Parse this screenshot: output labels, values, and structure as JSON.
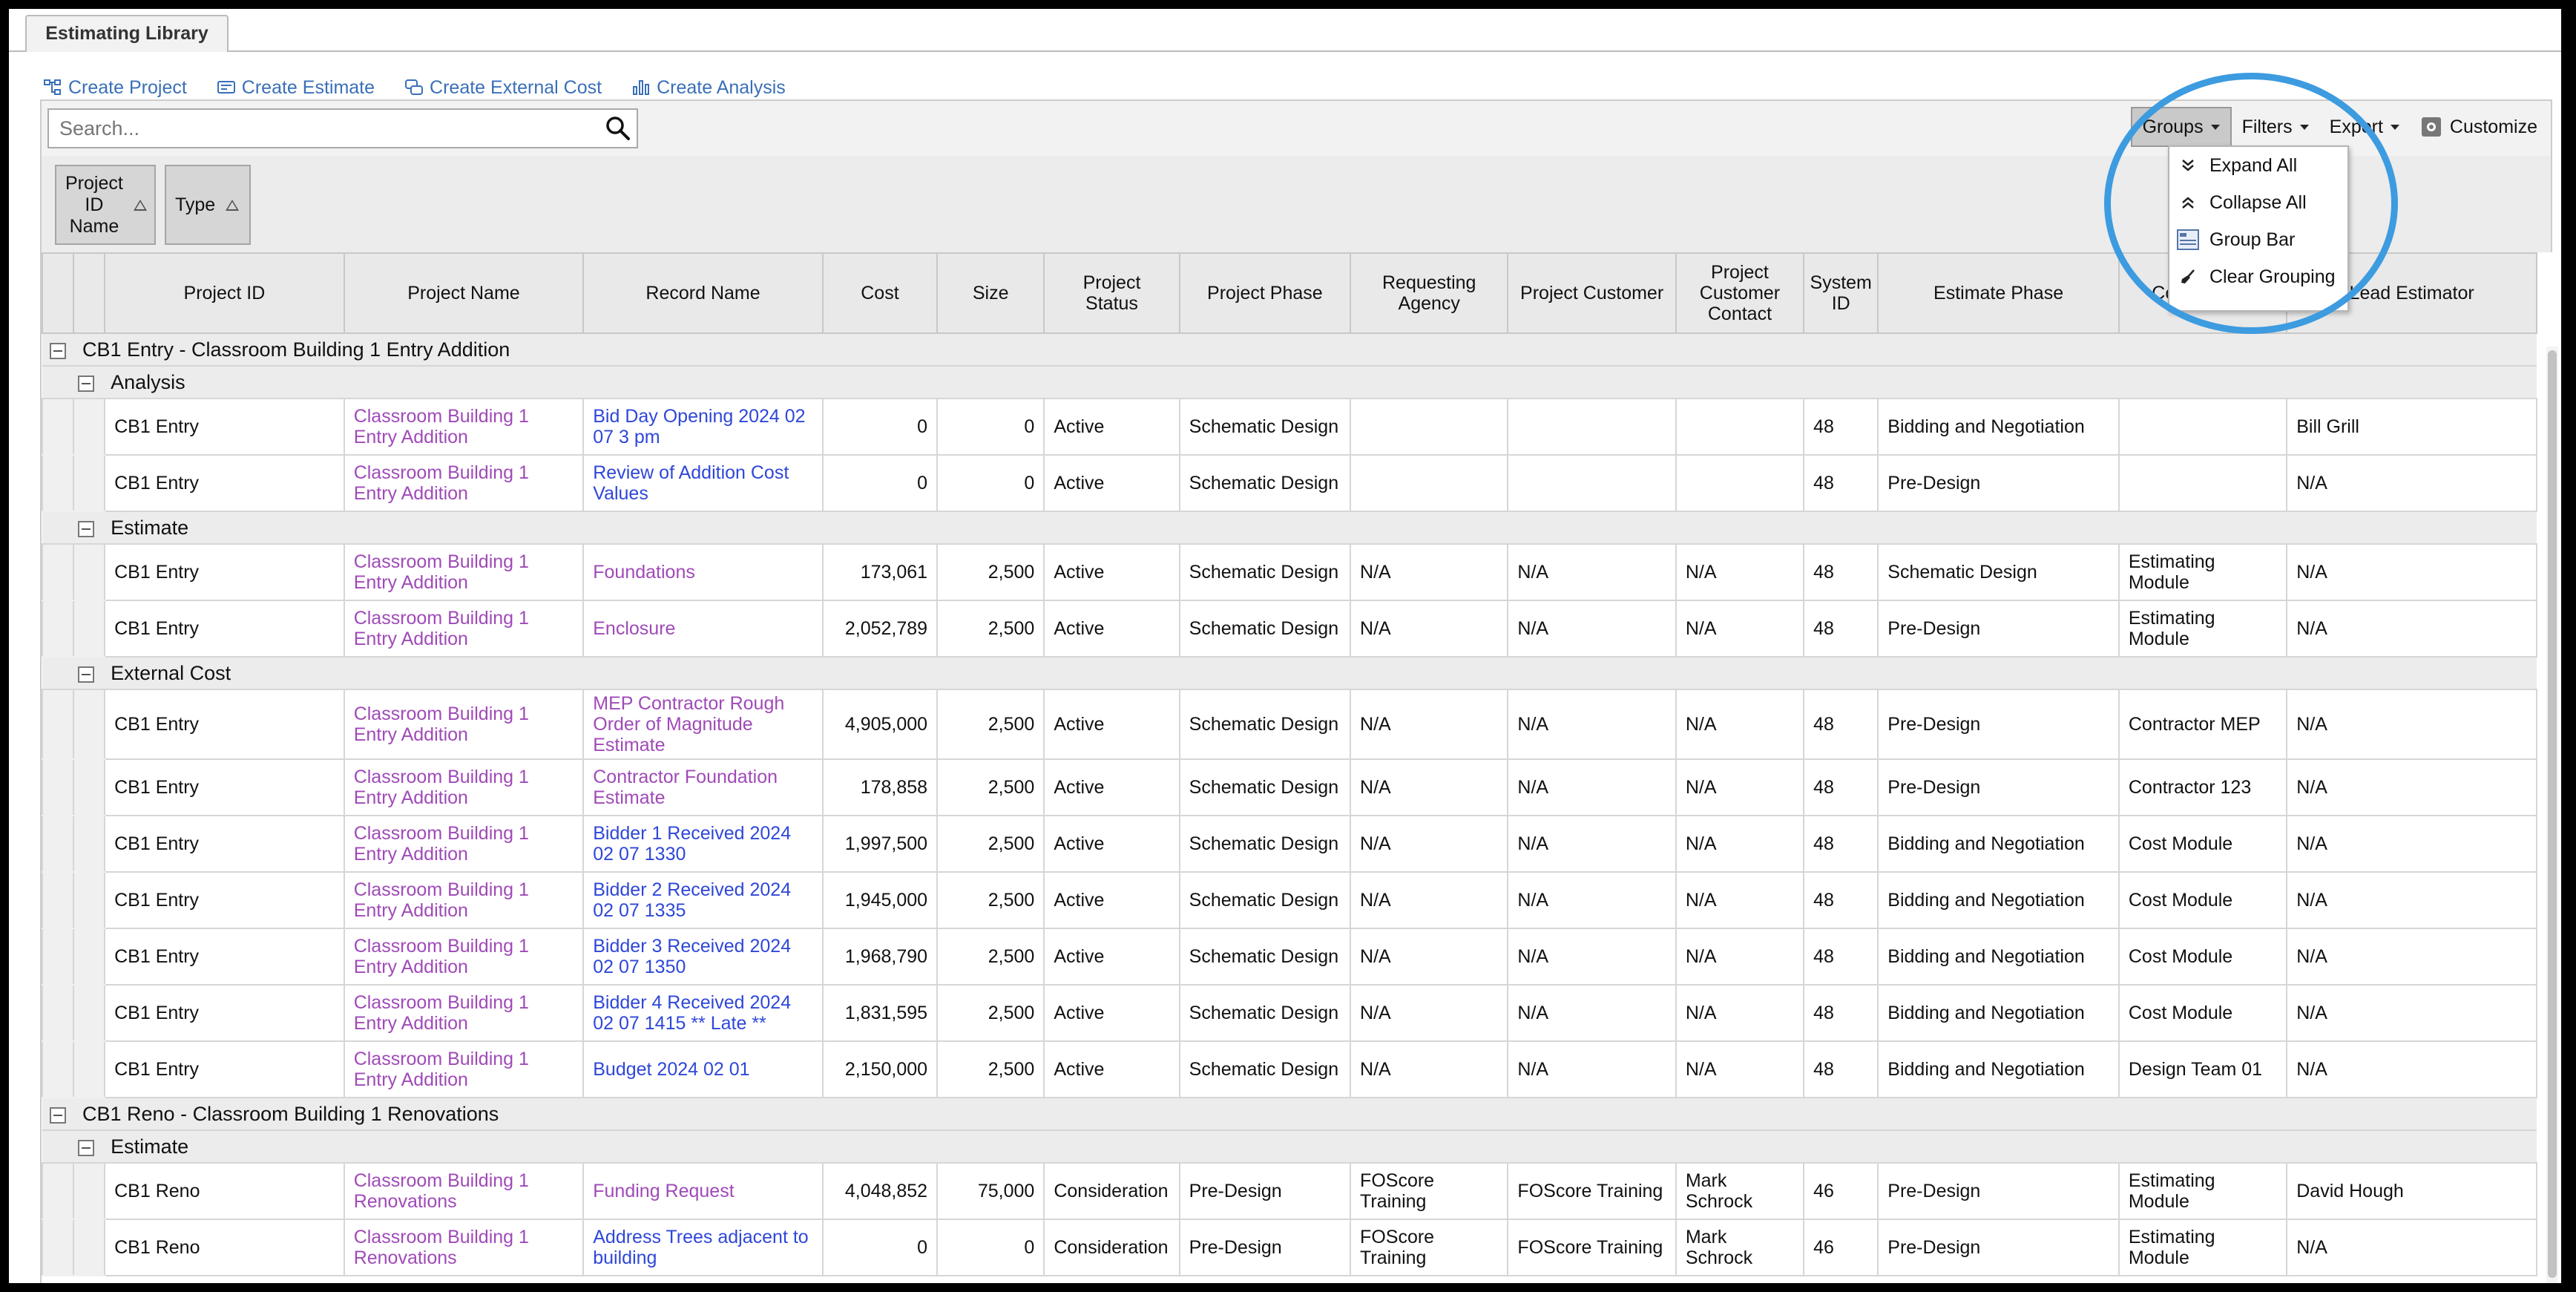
{
  "tab": "Estimating Library",
  "actions": [
    "Create Project",
    "Create Estimate",
    "Create External Cost",
    "Create Analysis"
  ],
  "search": {
    "placeholder": "Search..."
  },
  "toolbar": {
    "groups": "Groups",
    "filters": "Filters",
    "export": "Export",
    "customize": "Customize"
  },
  "group_chips": [
    {
      "lines": [
        "Project",
        "ID",
        "Name"
      ]
    },
    {
      "lines": [
        "Type"
      ]
    }
  ],
  "group_menu": [
    "Expand All",
    "Collapse All",
    "Group Bar",
    "Clear Grouping"
  ],
  "columns": [
    [
      "Project ID"
    ],
    [
      "Project Name"
    ],
    [
      "Record Name"
    ],
    [
      "Cost"
    ],
    [
      "Size"
    ],
    [
      "Project",
      "Status"
    ],
    [
      "Project Phase"
    ],
    [
      "Requesting",
      "Agency"
    ],
    [
      "Project Customer"
    ],
    [
      "Project",
      "Customer",
      "Contact"
    ],
    [
      "System",
      "ID"
    ],
    [
      "Estimate Phase"
    ],
    [
      "Cost Source"
    ],
    [
      "Lead Estimator"
    ]
  ],
  "groups": [
    {
      "label": "CB1 Entry - Classroom Building 1 Entry Addition",
      "subgroups": [
        {
          "label": "Analysis",
          "rows": [
            {
              "cells": [
                "CB1 Entry",
                "Classroom Building 1 Entry Addition",
                "Bid Day Opening 2024 02 07 3 pm",
                "0",
                "0",
                "Active",
                "Schematic Design",
                "",
                "",
                "",
                "48",
                "Bidding and Negotiation",
                "",
                "Bill Grill"
              ],
              "record_color": "blue"
            },
            {
              "cells": [
                "CB1 Entry",
                "Classroom Building 1 Entry Addition",
                "Review of Addition Cost Values",
                "0",
                "0",
                "Active",
                "Schematic Design",
                "",
                "",
                "",
                "48",
                "Pre-Design",
                "",
                "N/A"
              ],
              "record_color": "blue"
            }
          ]
        },
        {
          "label": "Estimate",
          "rows": [
            {
              "cells": [
                "CB1 Entry",
                "Classroom Building 1 Entry Addition",
                "Foundations",
                "173,061",
                "2,500",
                "Active",
                "Schematic Design",
                "N/A",
                "N/A",
                "N/A",
                "48",
                "Schematic Design",
                "Estimating Module",
                "N/A"
              ],
              "record_color": "purple"
            },
            {
              "cells": [
                "CB1 Entry",
                "Classroom Building 1 Entry Addition",
                "Enclosure",
                "2,052,789",
                "2,500",
                "Active",
                "Schematic Design",
                "N/A",
                "N/A",
                "N/A",
                "48",
                "Pre-Design",
                "Estimating Module",
                "N/A"
              ],
              "record_color": "purple"
            }
          ]
        },
        {
          "label": "External Cost",
          "rows": [
            {
              "cells": [
                "CB1 Entry",
                "Classroom Building 1 Entry Addition",
                "MEP Contractor Rough Order of Magnitude Estimate",
                "4,905,000",
                "2,500",
                "Active",
                "Schematic Design",
                "N/A",
                "N/A",
                "N/A",
                "48",
                "Pre-Design",
                "Contractor MEP",
                "N/A"
              ],
              "record_color": "purple"
            },
            {
              "cells": [
                "CB1 Entry",
                "Classroom Building 1 Entry Addition",
                "Contractor Foundation Estimate",
                "178,858",
                "2,500",
                "Active",
                "Schematic Design",
                "N/A",
                "N/A",
                "N/A",
                "48",
                "Pre-Design",
                "Contractor 123",
                "N/A"
              ],
              "record_color": "purple"
            },
            {
              "cells": [
                "CB1 Entry",
                "Classroom Building 1 Entry Addition",
                "Bidder 1 Received 2024 02 07 1330",
                "1,997,500",
                "2,500",
                "Active",
                "Schematic Design",
                "N/A",
                "N/A",
                "N/A",
                "48",
                "Bidding and Negotiation",
                "Cost Module",
                "N/A"
              ],
              "record_color": "blue"
            },
            {
              "cells": [
                "CB1 Entry",
                "Classroom Building 1 Entry Addition",
                "Bidder 2 Received 2024 02 07 1335",
                "1,945,000",
                "2,500",
                "Active",
                "Schematic Design",
                "N/A",
                "N/A",
                "N/A",
                "48",
                "Bidding and Negotiation",
                "Cost Module",
                "N/A"
              ],
              "record_color": "blue"
            },
            {
              "cells": [
                "CB1 Entry",
                "Classroom Building 1 Entry Addition",
                "Bidder 3 Received 2024 02 07 1350",
                "1,968,790",
                "2,500",
                "Active",
                "Schematic Design",
                "N/A",
                "N/A",
                "N/A",
                "48",
                "Bidding and Negotiation",
                "Cost Module",
                "N/A"
              ],
              "record_color": "blue"
            },
            {
              "cells": [
                "CB1 Entry",
                "Classroom Building 1 Entry Addition",
                "Bidder 4 Received 2024 02 07 1415 ** Late **",
                "1,831,595",
                "2,500",
                "Active",
                "Schematic Design",
                "N/A",
                "N/A",
                "N/A",
                "48",
                "Bidding and Negotiation",
                "Cost Module",
                "N/A"
              ],
              "record_color": "blue"
            },
            {
              "cells": [
                "CB1 Entry",
                "Classroom Building 1 Entry Addition",
                "Budget 2024 02 01",
                "2,150,000",
                "2,500",
                "Active",
                "Schematic Design",
                "N/A",
                "N/A",
                "N/A",
                "48",
                "Bidding and Negotiation",
                "Design Team 01",
                "N/A"
              ],
              "record_color": "blue"
            }
          ]
        }
      ]
    },
    {
      "label": "CB1 Reno - Classroom Building 1 Renovations",
      "subgroups": [
        {
          "label": "Estimate",
          "rows": [
            {
              "cells": [
                "CB1 Reno",
                "Classroom Building 1 Renovations",
                "Funding Request",
                "4,048,852",
                "75,000",
                "Consideration",
                "Pre-Design",
                "FOScore Training",
                "FOScore Training",
                "Mark Schrock",
                "46",
                "Pre-Design",
                "Estimating Module",
                "David Hough"
              ],
              "record_color": "purple"
            },
            {
              "cells": [
                "CB1 Reno",
                "Classroom Building 1 Renovations",
                "Address Trees adjacent to building",
                "0",
                "0",
                "Consideration",
                "Pre-Design",
                "FOScore Training",
                "FOScore Training",
                "Mark Schrock",
                "46",
                "Pre-Design",
                "Estimating Module",
                "N/A"
              ],
              "record_color": "blue"
            }
          ]
        }
      ]
    }
  ]
}
